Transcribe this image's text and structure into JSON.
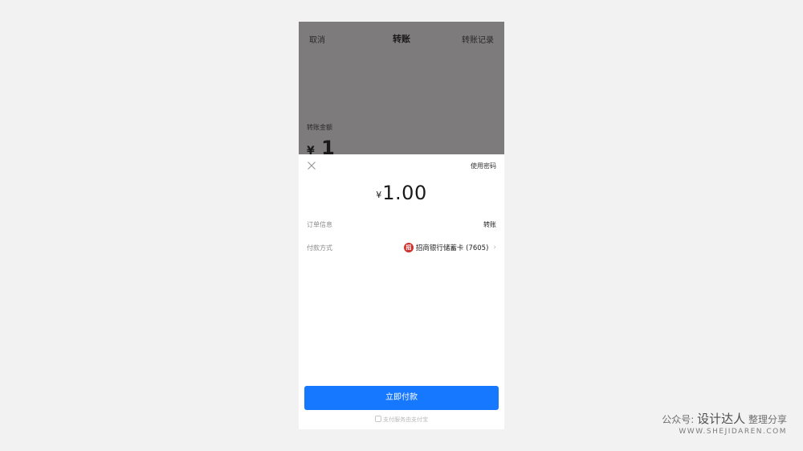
{
  "background_page": {
    "nav_left": "取消",
    "nav_title": "转账",
    "nav_right": "转账记录",
    "amount_label": "转账金额",
    "amount_currency": "¥",
    "amount_value": "1"
  },
  "sheet": {
    "close_icon": "close-icon",
    "use_password": "使用密码",
    "currency": "¥",
    "amount": "1.00",
    "order_label": "订单信息",
    "order_value": "转账",
    "method_label": "付款方式",
    "bank_logo_text": "招",
    "method_value": "招商银行储蓄卡 (7605)",
    "chevron": "›",
    "pay_button": "立即付款",
    "footer_note": "支付服务由支付宝"
  },
  "watermark": {
    "prefix": "公众号: ",
    "brand": "设计达人",
    "suffix": " 整理分享",
    "url": "WWW.SHEJIDAREN.COM"
  },
  "colors": {
    "accent": "#1677ff",
    "overlay": "#7d7b7c",
    "bank_red": "#d0312d"
  }
}
